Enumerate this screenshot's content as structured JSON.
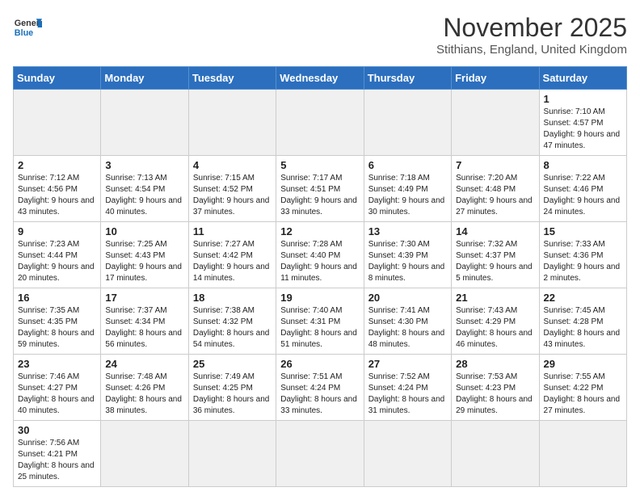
{
  "header": {
    "logo_general": "General",
    "logo_blue": "Blue",
    "title": "November 2025",
    "subtitle": "Stithians, England, United Kingdom"
  },
  "days_of_week": [
    "Sunday",
    "Monday",
    "Tuesday",
    "Wednesday",
    "Thursday",
    "Friday",
    "Saturday"
  ],
  "weeks": [
    [
      {
        "empty": true
      },
      {
        "empty": true
      },
      {
        "empty": true
      },
      {
        "empty": true
      },
      {
        "empty": true
      },
      {
        "empty": true
      },
      {
        "day": 1,
        "sunrise": "7:10 AM",
        "sunset": "4:57 PM",
        "daylight": "9 hours and 47 minutes."
      }
    ],
    [
      {
        "day": 2,
        "sunrise": "7:12 AM",
        "sunset": "4:56 PM",
        "daylight": "9 hours and 43 minutes."
      },
      {
        "day": 3,
        "sunrise": "7:13 AM",
        "sunset": "4:54 PM",
        "daylight": "9 hours and 40 minutes."
      },
      {
        "day": 4,
        "sunrise": "7:15 AM",
        "sunset": "4:52 PM",
        "daylight": "9 hours and 37 minutes."
      },
      {
        "day": 5,
        "sunrise": "7:17 AM",
        "sunset": "4:51 PM",
        "daylight": "9 hours and 33 minutes."
      },
      {
        "day": 6,
        "sunrise": "7:18 AM",
        "sunset": "4:49 PM",
        "daylight": "9 hours and 30 minutes."
      },
      {
        "day": 7,
        "sunrise": "7:20 AM",
        "sunset": "4:48 PM",
        "daylight": "9 hours and 27 minutes."
      },
      {
        "day": 8,
        "sunrise": "7:22 AM",
        "sunset": "4:46 PM",
        "daylight": "9 hours and 24 minutes."
      }
    ],
    [
      {
        "day": 9,
        "sunrise": "7:23 AM",
        "sunset": "4:44 PM",
        "daylight": "9 hours and 20 minutes."
      },
      {
        "day": 10,
        "sunrise": "7:25 AM",
        "sunset": "4:43 PM",
        "daylight": "9 hours and 17 minutes."
      },
      {
        "day": 11,
        "sunrise": "7:27 AM",
        "sunset": "4:42 PM",
        "daylight": "9 hours and 14 minutes."
      },
      {
        "day": 12,
        "sunrise": "7:28 AM",
        "sunset": "4:40 PM",
        "daylight": "9 hours and 11 minutes."
      },
      {
        "day": 13,
        "sunrise": "7:30 AM",
        "sunset": "4:39 PM",
        "daylight": "9 hours and 8 minutes."
      },
      {
        "day": 14,
        "sunrise": "7:32 AM",
        "sunset": "4:37 PM",
        "daylight": "9 hours and 5 minutes."
      },
      {
        "day": 15,
        "sunrise": "7:33 AM",
        "sunset": "4:36 PM",
        "daylight": "9 hours and 2 minutes."
      }
    ],
    [
      {
        "day": 16,
        "sunrise": "7:35 AM",
        "sunset": "4:35 PM",
        "daylight": "8 hours and 59 minutes."
      },
      {
        "day": 17,
        "sunrise": "7:37 AM",
        "sunset": "4:34 PM",
        "daylight": "8 hours and 56 minutes."
      },
      {
        "day": 18,
        "sunrise": "7:38 AM",
        "sunset": "4:32 PM",
        "daylight": "8 hours and 54 minutes."
      },
      {
        "day": 19,
        "sunrise": "7:40 AM",
        "sunset": "4:31 PM",
        "daylight": "8 hours and 51 minutes."
      },
      {
        "day": 20,
        "sunrise": "7:41 AM",
        "sunset": "4:30 PM",
        "daylight": "8 hours and 48 minutes."
      },
      {
        "day": 21,
        "sunrise": "7:43 AM",
        "sunset": "4:29 PM",
        "daylight": "8 hours and 46 minutes."
      },
      {
        "day": 22,
        "sunrise": "7:45 AM",
        "sunset": "4:28 PM",
        "daylight": "8 hours and 43 minutes."
      }
    ],
    [
      {
        "day": 23,
        "sunrise": "7:46 AM",
        "sunset": "4:27 PM",
        "daylight": "8 hours and 40 minutes."
      },
      {
        "day": 24,
        "sunrise": "7:48 AM",
        "sunset": "4:26 PM",
        "daylight": "8 hours and 38 minutes."
      },
      {
        "day": 25,
        "sunrise": "7:49 AM",
        "sunset": "4:25 PM",
        "daylight": "8 hours and 36 minutes."
      },
      {
        "day": 26,
        "sunrise": "7:51 AM",
        "sunset": "4:24 PM",
        "daylight": "8 hours and 33 minutes."
      },
      {
        "day": 27,
        "sunrise": "7:52 AM",
        "sunset": "4:24 PM",
        "daylight": "8 hours and 31 minutes."
      },
      {
        "day": 28,
        "sunrise": "7:53 AM",
        "sunset": "4:23 PM",
        "daylight": "8 hours and 29 minutes."
      },
      {
        "day": 29,
        "sunrise": "7:55 AM",
        "sunset": "4:22 PM",
        "daylight": "8 hours and 27 minutes."
      }
    ],
    [
      {
        "day": 30,
        "sunrise": "7:56 AM",
        "sunset": "4:21 PM",
        "daylight": "8 hours and 25 minutes."
      },
      {
        "empty": true
      },
      {
        "empty": true
      },
      {
        "empty": true
      },
      {
        "empty": true
      },
      {
        "empty": true
      },
      {
        "empty": true
      }
    ]
  ]
}
